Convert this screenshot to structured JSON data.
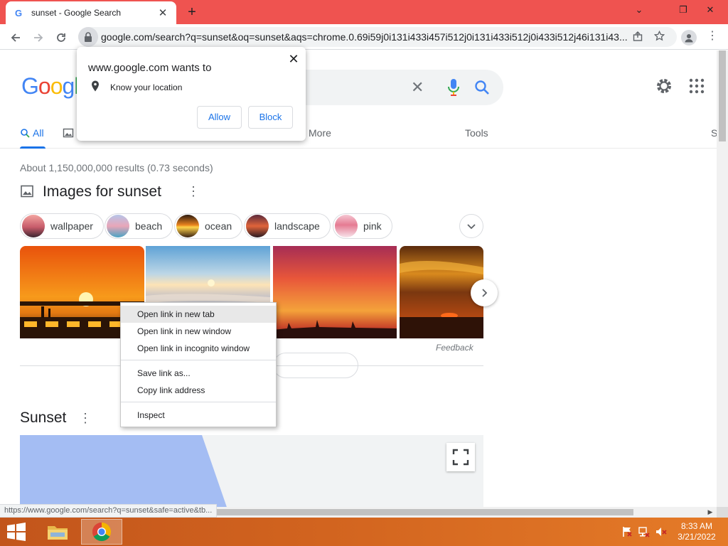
{
  "browser": {
    "tab_title": "sunset - Google Search",
    "tab_favicon": "G",
    "tab_close": "✕",
    "new_tab": "+",
    "window_controls": {
      "minimize": "⌄",
      "restore": "❐",
      "close": "✕"
    },
    "url": "google.com/search?q=sunset&oq=sunset&aqs=chrome.0.69i59j0i131i433i457i512j0i131i433i512j0i433i512j46i131i43..."
  },
  "google": {
    "logo_letters": [
      "G",
      "o",
      "o",
      "g",
      "l"
    ],
    "logo_colors": [
      "#4285f4",
      "#ea4335",
      "#fbbc05",
      "#4285f4",
      "#34a853"
    ],
    "clear_icon": "✕",
    "nav": {
      "all": "All",
      "more": "More",
      "tools": "Tools",
      "cut_item": "S"
    },
    "result_stats": "About 1,150,000,000 results (0.73 seconds)",
    "images_header": "Images for sunset",
    "chips": [
      {
        "label": "wallpaper",
        "thumb": "linear-gradient(180deg,#f3a5a0 0%,#c75b6a 55%,#3b2530 100%)"
      },
      {
        "label": "beach",
        "thumb": "linear-gradient(180deg,#b6c5e8 0%,#e9a6b8 50%,#4aa3c4 100%)"
      },
      {
        "label": "ocean",
        "thumb": "linear-gradient(180deg,#2b1a10 0%,#e8821d 45%,#ffd24a 55%,#3a2212 100%)"
      },
      {
        "label": "landscape",
        "thumb": "linear-gradient(180deg,#5b2a3c 0%,#e0643a 50%,#2a1b22 100%)"
      },
      {
        "label": "pink",
        "thumb": "linear-gradient(180deg,#f5c7d3 0%,#e57b92 45%,#f7e4ea 100%)"
      }
    ],
    "feedback": "Feedback",
    "sunset_header": "Sunset"
  },
  "permission_prompt": {
    "title": "www.google.com wants to",
    "request": "Know your location",
    "allow": "Allow",
    "block": "Block",
    "close": "✕"
  },
  "context_menu": {
    "items": [
      "Open link in new tab",
      "Open link in new window",
      "Open link in incognito window",
      "Save link as...",
      "Copy link address",
      "Inspect"
    ]
  },
  "status_bar_url": "https://www.google.com/search?q=sunset&safe=active&tb...",
  "taskbar": {
    "time": "8:33 AM",
    "date": "3/21/2022"
  }
}
